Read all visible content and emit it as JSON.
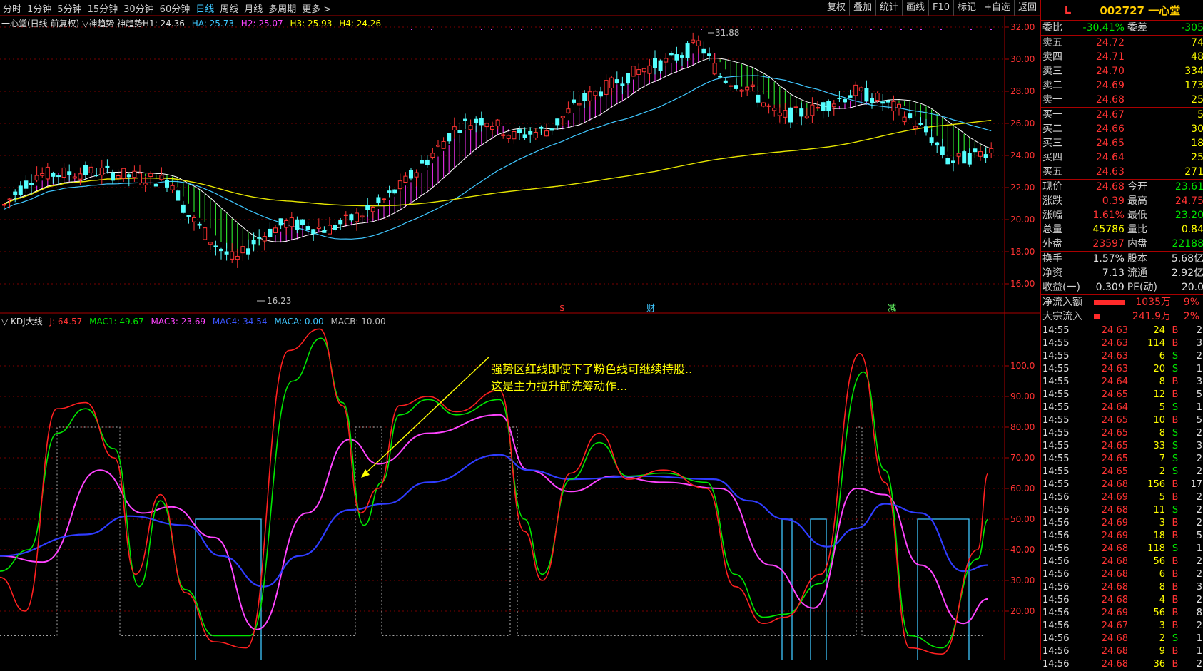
{
  "toolbar": {
    "periods": [
      "分时",
      "1分钟",
      "5分钟",
      "15分钟",
      "30分钟",
      "60分钟",
      "日线",
      "周线",
      "月线",
      "多周期",
      "更多 >"
    ],
    "active_period": "日线",
    "right_buttons": [
      "复权",
      "叠加",
      "统计",
      "画线",
      "F10",
      "标记",
      "+自选",
      "返回"
    ]
  },
  "main_chart": {
    "legend": {
      "title": "一心堂(日线 前复权) ▽神趋势 神趋势H1: 24.36",
      "ha": "HA: 25.73",
      "h2": "H2: 25.07",
      "h3": "H3: 25.93",
      "h4": "H4: 24.26"
    },
    "price_axis": [
      "32.00",
      "30.00",
      "28.00",
      "26.00",
      "24.00",
      "22.00",
      "20.00",
      "18.00",
      "16.00"
    ],
    "high_label": "31.88",
    "low_label": "16.23",
    "event_markers": [
      "$",
      "财",
      "减"
    ]
  },
  "kdj_chart": {
    "legend": {
      "name": "▽ KDJ大线",
      "j": "J: 64.57",
      "mac1": "MAC1: 49.67",
      "mac3": "MAC3: 23.69",
      "mac4": "MAC4: 34.54",
      "maca": "MACA: 0.00",
      "macb": "MACB: 10.00"
    },
    "axis": [
      "100.0",
      "90.00",
      "80.00",
      "70.00",
      "60.00",
      "50.00",
      "40.00",
      "30.00",
      "20.00"
    ],
    "annotation_line1": "强势区红线即使下了粉色线可继续持股..",
    "annotation_line2": "这是主力拉升前洗筹动作..."
  },
  "quote_panel": {
    "market_tag": "L",
    "code_name": "002727 一心堂",
    "weibi": {
      "label": "委比",
      "value": "-30.41%",
      "label2": "委差",
      "value2": "-305"
    },
    "asks": [
      {
        "label": "卖五",
        "price": "24.72",
        "vol": "74"
      },
      {
        "label": "卖四",
        "price": "24.71",
        "vol": "48"
      },
      {
        "label": "卖三",
        "price": "24.70",
        "vol": "334"
      },
      {
        "label": "卖二",
        "price": "24.69",
        "vol": "173"
      },
      {
        "label": "卖一",
        "price": "24.68",
        "vol": "25"
      }
    ],
    "bids": [
      {
        "label": "买一",
        "price": "24.67",
        "vol": "5"
      },
      {
        "label": "买二",
        "price": "24.66",
        "vol": "30"
      },
      {
        "label": "买三",
        "price": "24.65",
        "vol": "18"
      },
      {
        "label": "买四",
        "price": "24.64",
        "vol": "25"
      },
      {
        "label": "买五",
        "price": "24.63",
        "vol": "271"
      }
    ],
    "stats": [
      {
        "l1": "现价",
        "v1": "24.68",
        "c1": "red",
        "l2": "今开",
        "v2": "23.61",
        "c2": "grn"
      },
      {
        "l1": "涨跌",
        "v1": "0.39",
        "c1": "red",
        "l2": "最高",
        "v2": "24.75",
        "c2": "red"
      },
      {
        "l1": "涨幅",
        "v1": "1.61%",
        "c1": "red",
        "l2": "最低",
        "v2": "23.20",
        "c2": "grn"
      },
      {
        "l1": "总量",
        "v1": "45786",
        "c1": "yel",
        "l2": "量比",
        "v2": "0.84",
        "c2": "yel"
      },
      {
        "l1": "外盘",
        "v1": "23597",
        "c1": "red",
        "l2": "内盘",
        "v2": "22188",
        "c2": "grn"
      }
    ],
    "fundamentals": [
      {
        "l1": "换手",
        "v1": "1.57%",
        "l2": "股本",
        "v2": "5.68亿"
      },
      {
        "l1": "净资",
        "v1": "7.13",
        "l2": "流通",
        "v2": "2.92亿"
      },
      {
        "l1": "收益(一)",
        "v1": "0.309",
        "l2": "PE(动)",
        "v2": "20.0"
      }
    ],
    "flows": [
      {
        "label": "净流入额",
        "bar_pct": 82,
        "value": "1035万",
        "pct": "9%"
      },
      {
        "label": "大宗流入",
        "bar_pct": 18,
        "value": "241.9万",
        "pct": "2%"
      }
    ],
    "ticks": [
      {
        "t": "14:55",
        "p": "24.63",
        "v": "24",
        "bs": "B",
        "n": "2"
      },
      {
        "t": "14:55",
        "p": "24.63",
        "v": "114",
        "bs": "B",
        "n": "3"
      },
      {
        "t": "14:55",
        "p": "24.63",
        "v": "6",
        "bs": "S",
        "n": "2"
      },
      {
        "t": "14:55",
        "p": "24.63",
        "v": "20",
        "bs": "S",
        "n": "1"
      },
      {
        "t": "14:55",
        "p": "24.64",
        "v": "8",
        "bs": "B",
        "n": "3"
      },
      {
        "t": "14:55",
        "p": "24.65",
        "v": "12",
        "bs": "B",
        "n": "5"
      },
      {
        "t": "14:55",
        "p": "24.64",
        "v": "5",
        "bs": "S",
        "n": "1"
      },
      {
        "t": "14:55",
        "p": "24.65",
        "v": "10",
        "bs": "B",
        "n": "5"
      },
      {
        "t": "14:55",
        "p": "24.65",
        "v": "8",
        "bs": "S",
        "n": "2"
      },
      {
        "t": "14:55",
        "p": "24.65",
        "v": "33",
        "bs": "S",
        "n": "3"
      },
      {
        "t": "14:55",
        "p": "24.65",
        "v": "7",
        "bs": "S",
        "n": "2"
      },
      {
        "t": "14:55",
        "p": "24.65",
        "v": "2",
        "bs": "S",
        "n": "2"
      },
      {
        "t": "14:55",
        "p": "24.68",
        "v": "156",
        "bs": "B",
        "n": "17"
      },
      {
        "t": "14:56",
        "p": "24.69",
        "v": "5",
        "bs": "B",
        "n": "2"
      },
      {
        "t": "14:56",
        "p": "24.68",
        "v": "11",
        "bs": "S",
        "n": "2"
      },
      {
        "t": "14:56",
        "p": "24.69",
        "v": "3",
        "bs": "B",
        "n": "2"
      },
      {
        "t": "14:56",
        "p": "24.69",
        "v": "18",
        "bs": "B",
        "n": "5"
      },
      {
        "t": "14:56",
        "p": "24.68",
        "v": "118",
        "bs": "S",
        "n": "1"
      },
      {
        "t": "14:56",
        "p": "24.68",
        "v": "56",
        "bs": "B",
        "n": "2"
      },
      {
        "t": "14:56",
        "p": "24.68",
        "v": "6",
        "bs": "B",
        "n": "2"
      },
      {
        "t": "14:56",
        "p": "24.68",
        "v": "8",
        "bs": "B",
        "n": "3"
      },
      {
        "t": "14:56",
        "p": "24.68",
        "v": "4",
        "bs": "B",
        "n": "2"
      },
      {
        "t": "14:56",
        "p": "24.69",
        "v": "56",
        "bs": "B",
        "n": "8"
      },
      {
        "t": "14:56",
        "p": "24.67",
        "v": "3",
        "bs": "B",
        "n": "2"
      },
      {
        "t": "14:56",
        "p": "24.68",
        "v": "2",
        "bs": "S",
        "n": "1"
      },
      {
        "t": "14:56",
        "p": "24.68",
        "v": "9",
        "bs": "B",
        "n": "1"
      },
      {
        "t": "14:56",
        "p": "24.68",
        "v": "36",
        "bs": "B",
        "n": "2"
      }
    ],
    "colors": {
      "up": "#ff3333",
      "down": "#00e600",
      "buy": "#ff3333",
      "sell": "#00e600"
    }
  }
}
